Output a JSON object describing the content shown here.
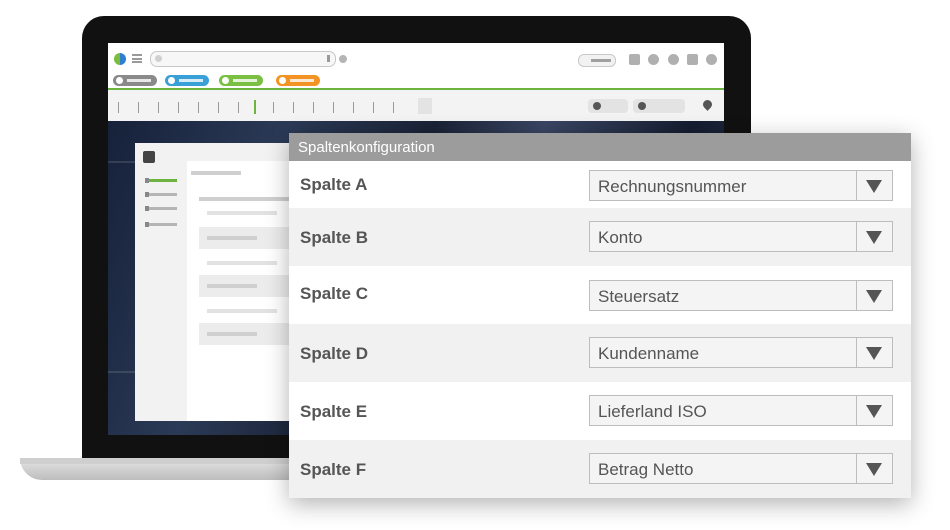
{
  "dialog": {
    "title": "Spaltenkonfiguration",
    "rows": [
      {
        "label": "Spalte A",
        "value": "Rechnungsnummer"
      },
      {
        "label": "Spalte B",
        "value": "Konto"
      },
      {
        "label": "Spalte C",
        "value": "Steuersatz"
      },
      {
        "label": "Spalte D",
        "value": "Kundenname"
      },
      {
        "label": "Spalte E",
        "value": "Lieferland ISO"
      },
      {
        "label": "Spalte F",
        "value": "Betrag Netto"
      }
    ]
  },
  "colors": {
    "accent_green": "#6db33f",
    "header_gray": "#9c9c9c",
    "text_gray": "#555555",
    "chip_colors": [
      "#8a8a8a",
      "#3aa0d8",
      "#7bc043",
      "#f39323"
    ]
  },
  "icons": {
    "dropdown": "triangle-down-icon",
    "app_logo": "app-logo-icon",
    "menu": "hamburger-icon"
  }
}
